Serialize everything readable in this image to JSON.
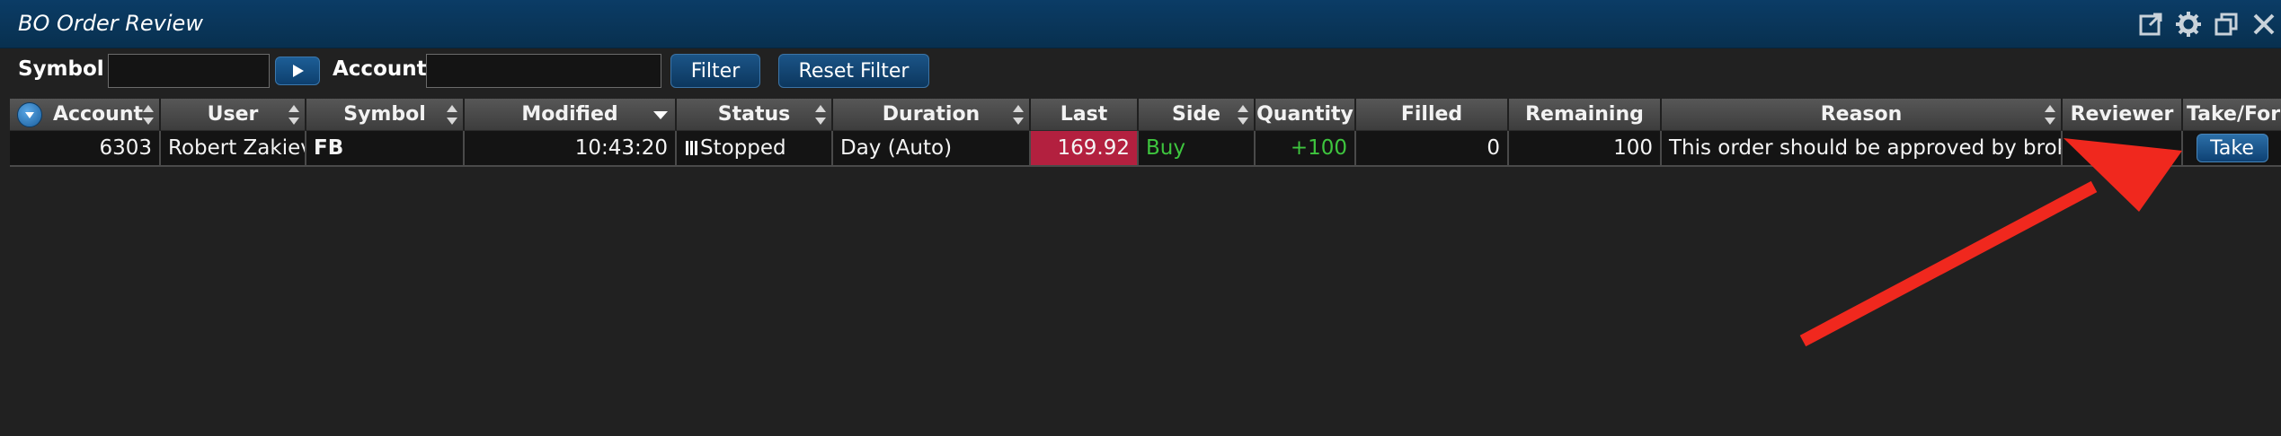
{
  "window": {
    "title": "BO Order Review",
    "icons": [
      "popout-icon",
      "gear-icon",
      "restore-icon",
      "close-icon"
    ]
  },
  "filters": {
    "symbol_label": "Symbol",
    "symbol_value": "",
    "account_label": "Account",
    "account_value": "",
    "filter_button": "Filter",
    "reset_button": "Reset Filter"
  },
  "table": {
    "columns": [
      "Account",
      "User",
      "Symbol",
      "Modified",
      "Status",
      "Duration",
      "Last",
      "Side",
      "Quantity",
      "Filled",
      "Remaining",
      "Reason",
      "Reviewer",
      "Take/Force"
    ],
    "rows": [
      {
        "account": "6303",
        "user": "Robert Zakiev",
        "symbol": "FB",
        "modified": "10:43:20",
        "status": "Stopped",
        "duration": "Day (Auto)",
        "last": "169.92",
        "side": "Buy",
        "quantity": "+100",
        "filled": "0",
        "remaining": "100",
        "reason": "This order should be approved by broker",
        "reviewer": "",
        "action": "Take"
      }
    ]
  },
  "colors": {
    "titlebar": "#0b3c66",
    "last_bg": "#b3203f",
    "buy_text": "#3ec53e",
    "annotation_arrow": "#f0281e"
  }
}
